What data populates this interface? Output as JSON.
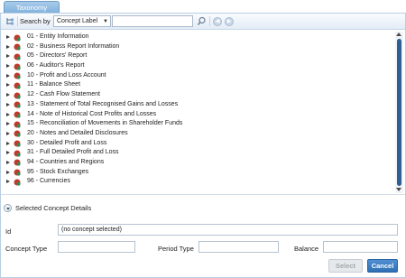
{
  "tab": {
    "label": "Taxonomy"
  },
  "toolbar": {
    "search_by_label": "Search by",
    "search_mode": "Concept Label",
    "search_value": ""
  },
  "tree": {
    "items": [
      {
        "label": "01 - Entity Information"
      },
      {
        "label": "02 - Business Report Information"
      },
      {
        "label": "05 - Directors' Report"
      },
      {
        "label": "06 - Auditor's Report"
      },
      {
        "label": "10 - Profit and Loss Account"
      },
      {
        "label": "11 - Balance Sheet"
      },
      {
        "label": "12 - Cash Flow Statement"
      },
      {
        "label": "13 - Statement of Total Recognised Gains and Losses"
      },
      {
        "label": "14 - Note of Historical Cost Profits and Losses"
      },
      {
        "label": "15 - Reconciliation of Movements in Shareholder Funds"
      },
      {
        "label": "20 - Notes and Detailed Disclosures"
      },
      {
        "label": "30 - Detailed Profit and Loss"
      },
      {
        "label": "31 - Full Detailed Profit and Loss"
      },
      {
        "label": "94 - Countries and Regions"
      },
      {
        "label": "95 - Stock Exchanges"
      },
      {
        "label": "96 - Currencies"
      }
    ]
  },
  "details": {
    "title": "Selected Concept Details",
    "id_label": "Id",
    "id_value": "(no concept selected)",
    "concept_type_label": "Concept Type",
    "concept_type_value": "",
    "period_type_label": "Period Type",
    "period_type_value": "",
    "balance_label": "Balance",
    "balance_value": ""
  },
  "buttons": {
    "select": "Select",
    "cancel": "Cancel"
  },
  "colors": {
    "accent": "#2f6fb4",
    "scroll_thumb": "#2f5f93",
    "tab": "#7fb0dd"
  }
}
